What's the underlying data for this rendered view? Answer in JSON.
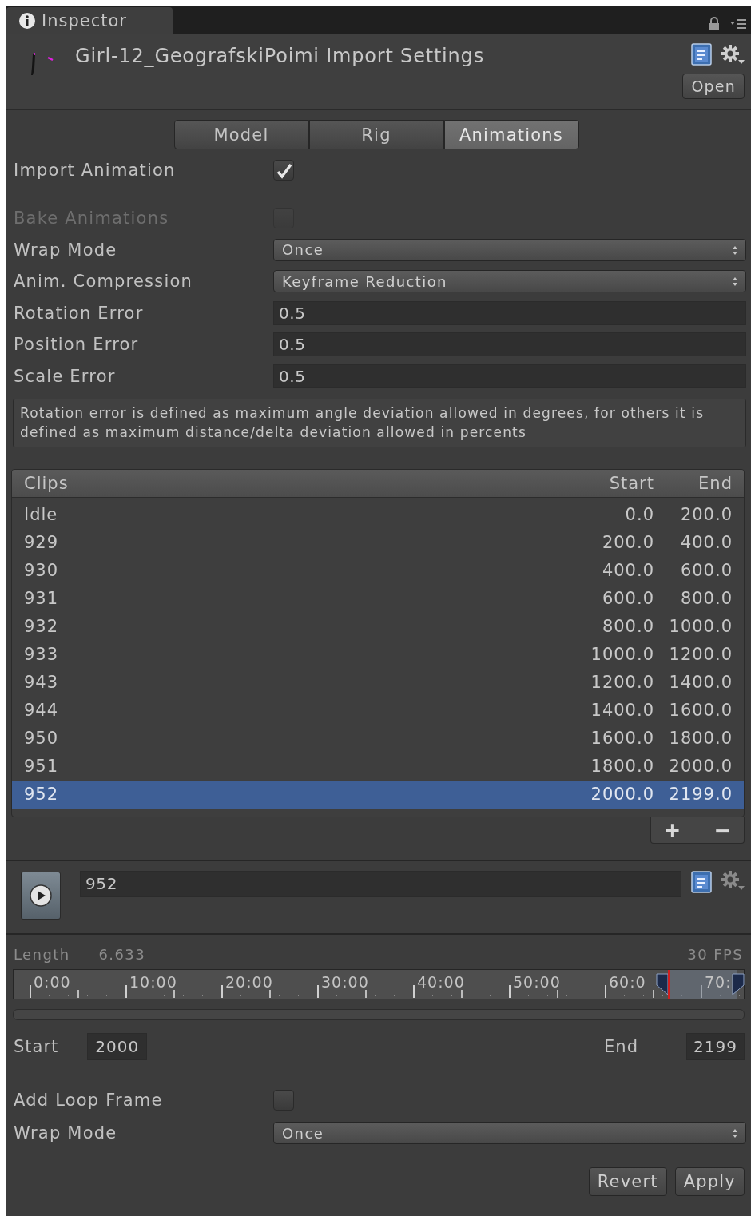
{
  "window_tab": {
    "label": "Inspector"
  },
  "header": {
    "title": "Girl-12_GeografskiPoimi Import Settings",
    "open_button": "Open"
  },
  "mode_tabs": [
    {
      "label": "Model",
      "selected": false
    },
    {
      "label": "Rig",
      "selected": false
    },
    {
      "label": "Animations",
      "selected": true
    }
  ],
  "settings": [
    {
      "kind": "checkbox",
      "label": "Import Animation",
      "checked": true,
      "disabled": false
    },
    {
      "kind": "checkbox",
      "label": "Bake Animations",
      "checked": false,
      "disabled": true
    },
    {
      "kind": "dropdown",
      "label": "Wrap Mode",
      "value": "Once"
    },
    {
      "kind": "dropdown",
      "label": "Anim. Compression",
      "value": "Keyframe Reduction"
    },
    {
      "kind": "number",
      "label": "Rotation Error",
      "value": "0.5"
    },
    {
      "kind": "number",
      "label": "Position Error",
      "value": "0.5"
    },
    {
      "kind": "number",
      "label": "Scale Error",
      "value": "0.5"
    }
  ],
  "help_text": "Rotation error is defined as maximum angle deviation allowed in degrees, for others it is defined as maximum distance/delta deviation allowed in percents",
  "clips": {
    "columns": [
      "Clips",
      "Start",
      "End"
    ],
    "rows": [
      {
        "name": "Idle",
        "start": "0.0",
        "end": "200.0",
        "selected": false
      },
      {
        "name": "929",
        "start": "200.0",
        "end": "400.0",
        "selected": false
      },
      {
        "name": "930",
        "start": "400.0",
        "end": "600.0",
        "selected": false
      },
      {
        "name": "931",
        "start": "600.0",
        "end": "800.0",
        "selected": false
      },
      {
        "name": "932",
        "start": "800.0",
        "end": "1000.0",
        "selected": false
      },
      {
        "name": "933",
        "start": "1000.0",
        "end": "1200.0",
        "selected": false
      },
      {
        "name": "943",
        "start": "1200.0",
        "end": "1400.0",
        "selected": false
      },
      {
        "name": "944",
        "start": "1400.0",
        "end": "1600.0",
        "selected": false
      },
      {
        "name": "950",
        "start": "1600.0",
        "end": "1800.0",
        "selected": false
      },
      {
        "name": "951",
        "start": "1800.0",
        "end": "2000.0",
        "selected": false
      },
      {
        "name": "952",
        "start": "2000.0",
        "end": "2199.0",
        "selected": true
      }
    ],
    "add_button": "+",
    "remove_button": "−"
  },
  "clip_editor": {
    "name": "952",
    "length_label": "Length",
    "length": "6.633",
    "fps": "30 FPS",
    "timeline_ticks": [
      "0:00",
      "10:00",
      "20:00",
      "30:00",
      "40:00",
      "50:00",
      "60:0",
      "70:"
    ],
    "start_label": "Start",
    "start": "2000",
    "end_label": "End",
    "end": "2199",
    "loop_frame": {
      "label": "Add Loop Frame",
      "checked": false
    },
    "wrap_mode": {
      "label": "Wrap Mode",
      "value": "Once"
    }
  },
  "buttons": [
    "Revert",
    "Apply"
  ]
}
